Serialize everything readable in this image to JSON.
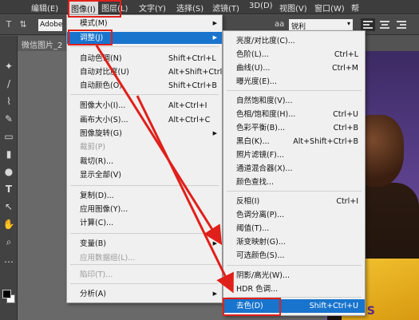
{
  "menubar": {
    "items": [
      "编辑(E)",
      "图像(I)",
      "图层(L)",
      "文字(Y)",
      "选择(S)",
      "滤镜(T)",
      "3D(D)",
      "视图(V)",
      "窗口(W)",
      "帮"
    ]
  },
  "options_bar": {
    "font_family": "Adobe",
    "antialias_value": "锐利",
    "antialias_icon": "aa"
  },
  "document_tab": {
    "title": "微信图片_2"
  },
  "image_menu": {
    "items": [
      {
        "label": "模式(M)",
        "shortcut": "",
        "submenu": true
      },
      {
        "label": "调整(J)",
        "shortcut": "",
        "submenu": true,
        "highlighted": true
      },
      {
        "label": "自动色调(N)",
        "shortcut": "Shift+Ctrl+L"
      },
      {
        "label": "自动对比度(U)",
        "shortcut": "Alt+Shift+Ctrl+L"
      },
      {
        "label": "自动颜色(O)",
        "shortcut": "Shift+Ctrl+B"
      },
      {
        "label": "图像大小(I)...",
        "shortcut": "Alt+Ctrl+I"
      },
      {
        "label": "画布大小(S)...",
        "shortcut": "Alt+Ctrl+C"
      },
      {
        "label": "图像旋转(G)",
        "shortcut": "",
        "submenu": true
      },
      {
        "label": "裁剪(P)",
        "shortcut": "",
        "disabled": true
      },
      {
        "label": "裁切(R)...",
        "shortcut": ""
      },
      {
        "label": "显示全部(V)",
        "shortcut": ""
      },
      {
        "label": "复制(D)...",
        "shortcut": ""
      },
      {
        "label": "应用图像(Y)...",
        "shortcut": ""
      },
      {
        "label": "计算(C)...",
        "shortcut": ""
      },
      {
        "label": "变量(B)",
        "shortcut": "",
        "submenu": true
      },
      {
        "label": "应用数据组(L)...",
        "shortcut": "",
        "disabled": true
      },
      {
        "label": "陷印(T)...",
        "shortcut": "",
        "disabled": true
      },
      {
        "label": "分析(A)",
        "shortcut": "",
        "submenu": true
      }
    ]
  },
  "adjust_menu": {
    "items": [
      {
        "label": "亮度/对比度(C)...",
        "shortcut": ""
      },
      {
        "label": "色阶(L)...",
        "shortcut": "Ctrl+L"
      },
      {
        "label": "曲线(U)...",
        "shortcut": "Ctrl+M"
      },
      {
        "label": "曝光度(E)...",
        "shortcut": ""
      },
      {
        "label": "自然饱和度(V)...",
        "shortcut": ""
      },
      {
        "label": "色相/饱和度(H)...",
        "shortcut": "Ctrl+U"
      },
      {
        "label": "色彩平衡(B)...",
        "shortcut": "Ctrl+B"
      },
      {
        "label": "黑白(K)...",
        "shortcut": "Alt+Shift+Ctrl+B"
      },
      {
        "label": "照片滤镜(F)...",
        "shortcut": ""
      },
      {
        "label": "通道混合器(X)...",
        "shortcut": ""
      },
      {
        "label": "颜色查找...",
        "shortcut": ""
      },
      {
        "label": "反相(I)",
        "shortcut": "Ctrl+I"
      },
      {
        "label": "色调分离(P)...",
        "shortcut": ""
      },
      {
        "label": "阈值(T)...",
        "shortcut": ""
      },
      {
        "label": "渐变映射(G)...",
        "shortcut": ""
      },
      {
        "label": "可选颜色(S)...",
        "shortcut": ""
      },
      {
        "label": "阴影/高光(W)...",
        "shortcut": ""
      },
      {
        "label": "HDR 色调...",
        "shortcut": ""
      },
      {
        "label": "去色(D)",
        "shortcut": "Shift+Ctrl+U",
        "highlighted": true
      }
    ]
  },
  "photo": {
    "jersey_text": "RS"
  },
  "annotation_color": "#e0201a",
  "highlight_color": "#1874cd"
}
